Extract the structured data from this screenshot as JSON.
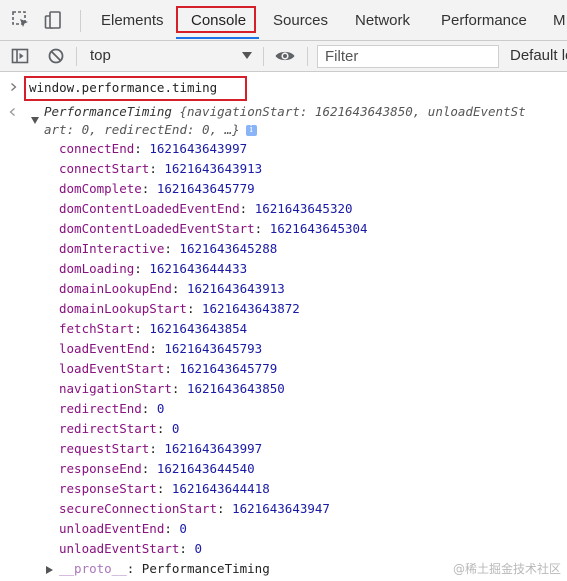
{
  "devtools": {
    "tabs": [
      {
        "label": "Elements"
      },
      {
        "label": "Console"
      },
      {
        "label": "Sources"
      },
      {
        "label": "Network"
      },
      {
        "label": "Performance"
      },
      {
        "label": "M"
      }
    ],
    "active_tab": "Console",
    "accent_color": "#1a73e8",
    "highlight_color": "#d51f2a"
  },
  "console_toolbar": {
    "context": "top",
    "filter_placeholder": "Filter",
    "levels_label": "Default le"
  },
  "console": {
    "input_command": "window.performance.timing",
    "object_summary": {
      "type_name": "PerformanceTiming",
      "line1_rest": " {navigationStart: 1621643643850, unloadEventSt",
      "line2": "art: 0, redirectEnd: 0, …}",
      "info_badge": "i"
    },
    "properties": [
      {
        "key": "connectEnd",
        "value": "1621643643997"
      },
      {
        "key": "connectStart",
        "value": "1621643643913"
      },
      {
        "key": "domComplete",
        "value": "1621643645779"
      },
      {
        "key": "domContentLoadedEventEnd",
        "value": "1621643645320"
      },
      {
        "key": "domContentLoadedEventStart",
        "value": "1621643645304"
      },
      {
        "key": "domInteractive",
        "value": "1621643645288"
      },
      {
        "key": "domLoading",
        "value": "1621643644433"
      },
      {
        "key": "domainLookupEnd",
        "value": "1621643643913"
      },
      {
        "key": "domainLookupStart",
        "value": "1621643643872"
      },
      {
        "key": "fetchStart",
        "value": "1621643643854"
      },
      {
        "key": "loadEventEnd",
        "value": "1621643645793"
      },
      {
        "key": "loadEventStart",
        "value": "1621643645779"
      },
      {
        "key": "navigationStart",
        "value": "1621643643850"
      },
      {
        "key": "redirectEnd",
        "value": "0"
      },
      {
        "key": "redirectStart",
        "value": "0"
      },
      {
        "key": "requestStart",
        "value": "1621643643997"
      },
      {
        "key": "responseEnd",
        "value": "1621643644540"
      },
      {
        "key": "responseStart",
        "value": "1621643644418"
      },
      {
        "key": "secureConnectionStart",
        "value": "1621643643947"
      },
      {
        "key": "unloadEventEnd",
        "value": "0"
      },
      {
        "key": "unloadEventStart",
        "value": "0"
      }
    ],
    "proto": {
      "key": "__proto__",
      "value": "PerformanceTiming"
    }
  },
  "watermark": "@稀土掘金技术社区"
}
